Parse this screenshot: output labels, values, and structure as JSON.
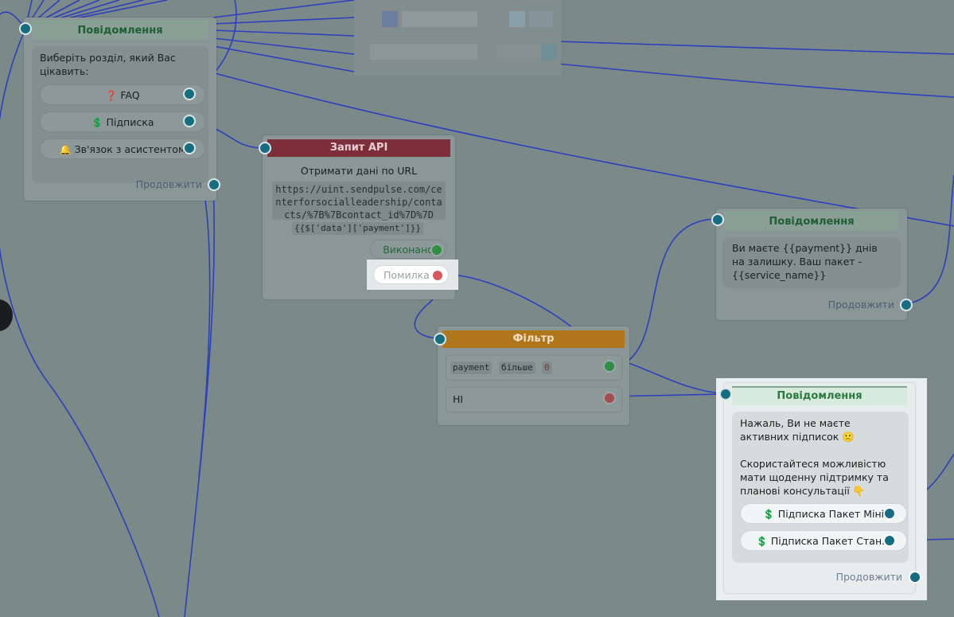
{
  "colors": {
    "canvas_bg": "#7b8a89",
    "line": "#2c3fbf",
    "port_blue": "#146d80",
    "success": "#2e8f43",
    "error": "#a54e4e",
    "message_header": "#2c7a41",
    "api_header": "#7c2e3a",
    "filter_header": "#b0761b"
  },
  "message1": {
    "title": "Повідомлення",
    "text": "Виберіть розділ, який Вас цікавить:",
    "buttons": [
      {
        "icon": "question-icon",
        "glyph": "❓",
        "label": "FAQ"
      },
      {
        "icon": "dollar-icon",
        "glyph": "💲",
        "label": "Підписка"
      },
      {
        "icon": "bell-icon",
        "glyph": "🔔",
        "label": "Зв'язок з асистентом"
      }
    ],
    "continue": "Продовжити"
  },
  "api": {
    "title": "Запит API",
    "subtitle": "Отримати дані по URL",
    "url_lines": [
      "https://uint.sendpulse.com/ce",
      "nterforsocialleadership/conta",
      "cts/%7B%7Bcontact_id%7D%7D"
    ],
    "var": "{{$['data']['payment']}}",
    "success": "Виконано",
    "error": "Помилка"
  },
  "filter": {
    "title": "Фільтр",
    "condition": [
      "payment",
      "більше",
      "0"
    ],
    "else": "НІ"
  },
  "message2": {
    "title": "Повідомлення",
    "text": "Ви маєте {{payment}} днів на залишку. Ваш пакет - {{service_name}}",
    "continue": "Продовжити"
  },
  "message3": {
    "title": "Повідомлення",
    "text_line1": "Нажаль, Ви не маєте активних підписок",
    "sad_glyph": "🙁",
    "text_line2": " Скористайтеся можливістю мати щоденну підтримку та планові консультації",
    "point_glyph": "👇",
    "buttons": [
      {
        "icon": "dollar-icon",
        "glyph": "💲",
        "label": "Підписка Пакет Міні"
      },
      {
        "icon": "dollar-icon",
        "glyph": "💲",
        "label": "Підписка Пакет Стан..."
      }
    ],
    "continue": "Продовжити"
  }
}
